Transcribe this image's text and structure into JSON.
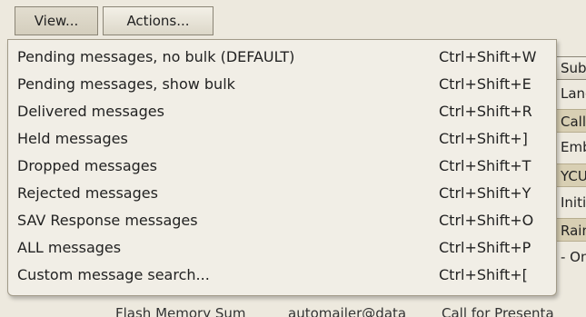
{
  "toolbar": {
    "view_label": "View...",
    "actions_label": "Actions..."
  },
  "menu": {
    "items": [
      {
        "label": "Pending messages, no bulk (DEFAULT)",
        "shortcut": "Ctrl+Shift+W"
      },
      {
        "label": "Pending messages, show bulk",
        "shortcut": "Ctrl+Shift+E"
      },
      {
        "label": "Delivered messages",
        "shortcut": "Ctrl+Shift+R"
      },
      {
        "label": "Held messages",
        "shortcut": "Ctrl+Shift+]"
      },
      {
        "label": "Dropped messages",
        "shortcut": "Ctrl+Shift+T"
      },
      {
        "label": "Rejected messages",
        "shortcut": "Ctrl+Shift+Y"
      },
      {
        "label": "SAV Response messages",
        "shortcut": "Ctrl+Shift+O"
      },
      {
        "label": "ALL messages",
        "shortcut": "Ctrl+Shift+P"
      },
      {
        "label": "Custom message search...",
        "shortcut": "Ctrl+Shift+["
      }
    ]
  },
  "table": {
    "subject_header": "Subje",
    "subject_cells": [
      "Land",
      "Calle",
      "Embri",
      "YCU",
      "Initi",
      "Rain",
      "- On"
    ],
    "bottom_row": {
      "col1": "Flash Memory Sum",
      "col2": "automailer@data",
      "col3": "Call for Presenta"
    }
  },
  "colors": {
    "background": "#ede9de",
    "menu_background": "#f1eee6",
    "highlight_row": "#d8cfb3"
  }
}
